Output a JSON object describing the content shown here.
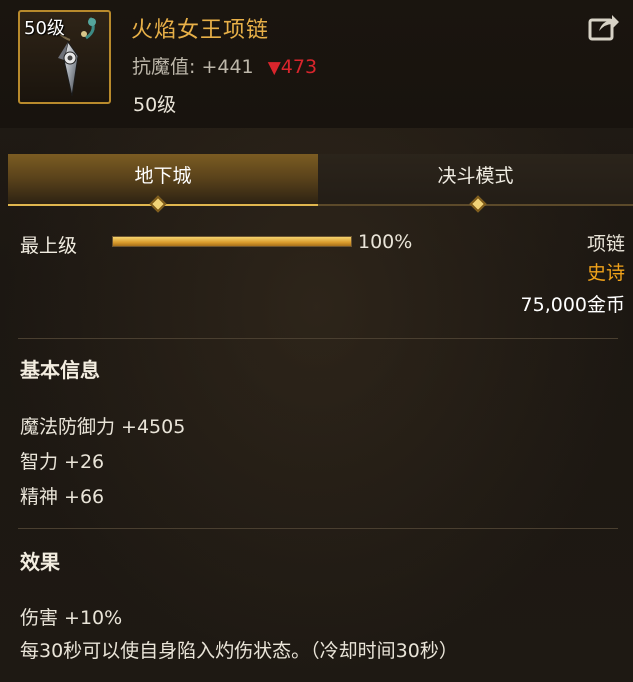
{
  "item": {
    "badge_level": "50级",
    "name": "火焰女王项链",
    "stat_label": "抗魔值:",
    "stat_value": "+441",
    "compare_arrow": "▼",
    "compare_value": "473",
    "required_level": "50级"
  },
  "tabs": [
    {
      "label": "地下城",
      "active": true
    },
    {
      "label": "决斗模式",
      "active": false
    }
  ],
  "upgrade": {
    "label": "最上级",
    "percent_text": "100%",
    "progress": 1.0
  },
  "meta": {
    "slot": "项链",
    "rarity": "史诗",
    "price": "75,000金币"
  },
  "basic_info": {
    "title": "基本信息",
    "stats": [
      "魔法防御力 +4505",
      "智力 +26",
      "精神 +66"
    ]
  },
  "effects": {
    "title": "效果",
    "lines": [
      "伤害 +10%",
      "每30秒可以使自身陷入灼伤状态。（冷却时间30秒）"
    ]
  },
  "colors": {
    "item_name": "#e8b048",
    "rarity": "#f0a21a",
    "decrease": "#d9252c",
    "accent_gold": "#e0b64e"
  },
  "icons": {
    "share": "share-arrow-icon",
    "item": "necklace-icon"
  }
}
